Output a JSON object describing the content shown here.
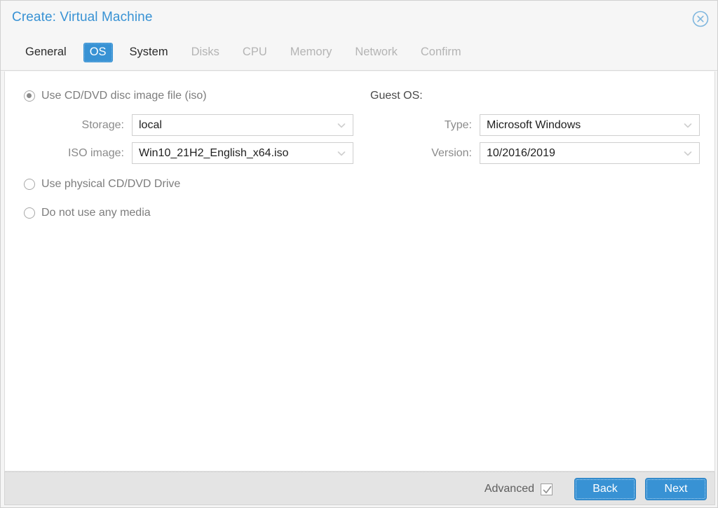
{
  "window": {
    "title": "Create: Virtual Machine",
    "close_icon": "close-circle-icon",
    "accent_color": "#3892d4"
  },
  "tabs": [
    {
      "label": "General",
      "state": "enabled"
    },
    {
      "label": "OS",
      "state": "active"
    },
    {
      "label": "System",
      "state": "enabled"
    },
    {
      "label": "Disks",
      "state": "disabled"
    },
    {
      "label": "CPU",
      "state": "disabled"
    },
    {
      "label": "Memory",
      "state": "disabled"
    },
    {
      "label": "Network",
      "state": "disabled"
    },
    {
      "label": "Confirm",
      "state": "disabled"
    }
  ],
  "media": {
    "option_iso": "Use CD/DVD disc image file (iso)",
    "option_physical": "Use physical CD/DVD Drive",
    "option_none": "Do not use any media",
    "selected": "iso",
    "storage_label": "Storage:",
    "storage_value": "local",
    "iso_label": "ISO image:",
    "iso_value": "Win10_21H2_English_x64.iso"
  },
  "guest_os": {
    "heading": "Guest OS:",
    "type_label": "Type:",
    "type_value": "Microsoft Windows",
    "version_label": "Version:",
    "version_value": "10/2016/2019"
  },
  "footer": {
    "advanced_label": "Advanced",
    "advanced_checked": true,
    "back_label": "Back",
    "next_label": "Next"
  }
}
